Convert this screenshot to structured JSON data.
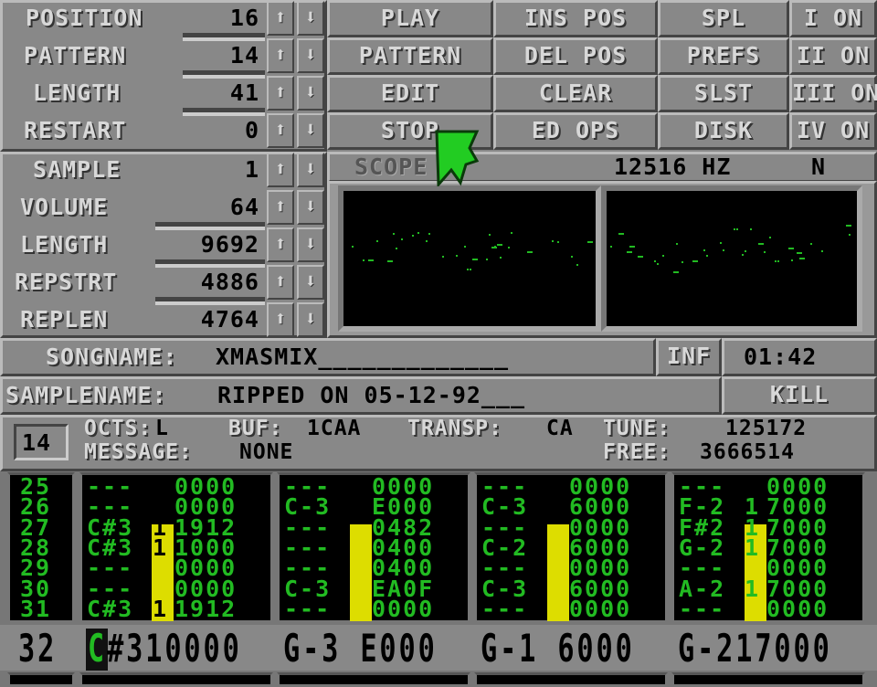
{
  "song_controls": [
    {
      "label": "POSITION",
      "value": "16"
    },
    {
      "label": "PATTERN",
      "value": "14"
    },
    {
      "label": "LENGTH",
      "value": "41"
    },
    {
      "label": "RESTART",
      "value": "0"
    }
  ],
  "sample_controls": [
    {
      "label": "SAMPLE",
      "value": "1"
    },
    {
      "label": "VOLUME",
      "value": "64"
    },
    {
      "label": "LENGTH",
      "value": "9692"
    },
    {
      "label": "REPSTRT",
      "value": "4886"
    },
    {
      "label": "REPLEN",
      "value": "4764"
    }
  ],
  "arrows": {
    "up": "⬆",
    "down": "⬇"
  },
  "buttons": {
    "col1": [
      "PLAY",
      "PATTERN",
      "EDIT",
      "STOP"
    ],
    "col2": [
      "INS POS",
      "DEL POS",
      "CLEAR",
      "ED OPS"
    ],
    "col3": [
      "SPL",
      "PREFS",
      "SLST",
      "DISK"
    ],
    "channels": [
      "I ON",
      "II ON",
      "III ON",
      "IV ON"
    ]
  },
  "scope": {
    "label": "SCOPE",
    "freq": "12516 HZ",
    "mode": "N",
    "trace_color": "#22bb22"
  },
  "songname": {
    "label": "SONGNAME:",
    "value": "XMASMIX_____________",
    "inf": "INF",
    "time": "01:42"
  },
  "samplename": {
    "label": "SAMPLENAME:",
    "value": "RIPPED ON 05-12-92___",
    "kill": "KILL"
  },
  "status": {
    "pattern_num": "14",
    "octs_label": "OCTS:",
    "octs_value": "L",
    "buf_label": "BUF:",
    "buf_value": "1CAA",
    "transp_label": "TRANSP:",
    "transp_value": "CA",
    "tune_label": "TUNE:",
    "tune_value": "125172",
    "message_label": "MESSAGE:",
    "message_value": "NONE",
    "free_label": "FREE:",
    "free_value": "3666514"
  },
  "pattern": {
    "rows": [
      "25",
      "26",
      "27",
      "28",
      "29",
      "30",
      "31"
    ],
    "tracks": [
      {
        "notes": [
          "---",
          "---",
          "C#3",
          "C#3",
          "---",
          "---",
          "C#3"
        ],
        "inst": [
          "",
          "",
          "1",
          "1",
          "",
          "",
          "1"
        ],
        "fx": [
          "0000",
          "0000",
          "1912",
          "1000",
          "0000",
          "0000",
          "1912"
        ]
      },
      {
        "notes": [
          "---",
          "C-3",
          "---",
          "---",
          "---",
          "C-3",
          "---"
        ],
        "inst": [
          "",
          "",
          "",
          "",
          "",
          "",
          ""
        ],
        "fx": [
          "0000",
          "E000",
          "0482",
          "0400",
          "0400",
          "EA0F",
          "0000"
        ]
      },
      {
        "notes": [
          "---",
          "C-3",
          "---",
          "C-2",
          "---",
          "C-3",
          "---"
        ],
        "inst": [
          "",
          "",
          "",
          "",
          "",
          "",
          ""
        ],
        "fx": [
          "0000",
          "6000",
          "0000",
          "6000",
          "0000",
          "6000",
          "0000"
        ]
      },
      {
        "notes": [
          "---",
          "F-2",
          "F#2",
          "G-2",
          "---",
          "A-2",
          "---"
        ],
        "inst": [
          "",
          "1",
          "1",
          "1",
          "",
          "1",
          ""
        ],
        "fx": [
          "0000",
          "7000",
          "7000",
          "7000",
          "0000",
          "7000",
          "0000"
        ]
      }
    ],
    "current_row": "32",
    "current": [
      "C#310000",
      "G-3 E000",
      "G-1 6000",
      "G-217000"
    ],
    "cursor_char": "C"
  }
}
